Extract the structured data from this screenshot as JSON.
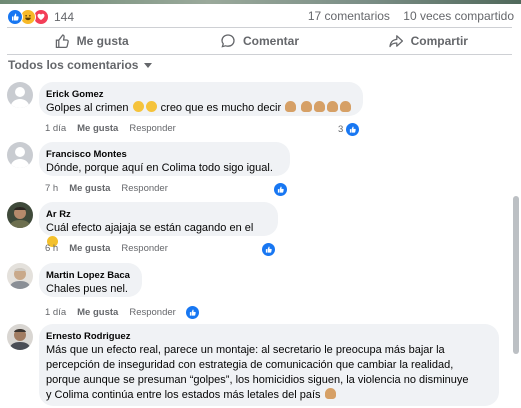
{
  "post": {
    "reaction_count": "144",
    "comments_count": "17 comentarios",
    "shares_count": "10 veces compartido",
    "reaction_types": [
      "like-icon",
      "haha-icon",
      "love-icon"
    ]
  },
  "actions": {
    "like": "Me gusta",
    "comment": "Comentar",
    "share": "Compartir"
  },
  "filter": {
    "label": "Todos los comentarios"
  },
  "comments": [
    {
      "author": "Erick Gomez",
      "text_a": "Golpes al crimen ",
      "text_b": " creo que es mucho decir ",
      "time": "1 día",
      "like_label": "Me gusta",
      "reply_label": "Responder",
      "likes": "3"
    },
    {
      "author": "Francisco Montes",
      "text": "Dónde, porque aquí en Colima todo sigo igual.",
      "time": "7 h",
      "like_label": "Me gusta",
      "reply_label": "Responder"
    },
    {
      "author": "Ar Rz",
      "text": "Cuál efecto ajajaja se están cagando en el ",
      "time": "6 h",
      "like_label": "Me gusta",
      "reply_label": "Responder"
    },
    {
      "author": "Martin Lopez Baca",
      "text": "Chales pues nel.",
      "time": "1 día",
      "like_label": "Me gusta",
      "reply_label": "Responder"
    },
    {
      "author": "Ernesto Rodriguez",
      "lines": [
        "Más que un efecto real, parece un montaje: al secretario le preocupa más bajar la",
        "percepción de inseguridad con estrategia de comunicación que cambiar la realidad,",
        "porque aunque se presuman “golpes”, los homicidios siguen, la violencia no disminuye",
        "y Colima continúa entre los estados más letales del país "
      ]
    }
  ],
  "colors": {
    "accent": "#1877f2",
    "bubble": "#f0f2f5",
    "muted": "#65676b"
  }
}
